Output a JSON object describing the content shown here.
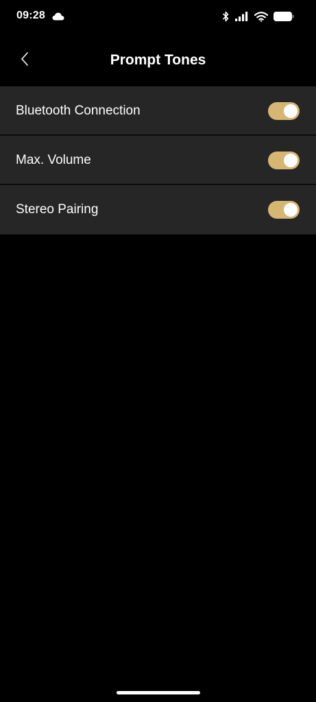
{
  "status_bar": {
    "time": "09:28",
    "icons": [
      "cloud-icon",
      "bluetooth-icon",
      "signal-icon",
      "wifi-icon",
      "battery-icon"
    ]
  },
  "header": {
    "title": "Prompt Tones",
    "back_icon": "chevron-left-icon"
  },
  "settings": [
    {
      "label": "Bluetooth Connection",
      "enabled": true
    },
    {
      "label": "Max. Volume",
      "enabled": true
    },
    {
      "label": "Stereo Pairing",
      "enabled": true
    }
  ],
  "colors": {
    "background": "#000000",
    "row_background": "#262626",
    "toggle_on": "#d7b572",
    "toggle_knob": "#ffffff",
    "text": "#ffffff"
  }
}
